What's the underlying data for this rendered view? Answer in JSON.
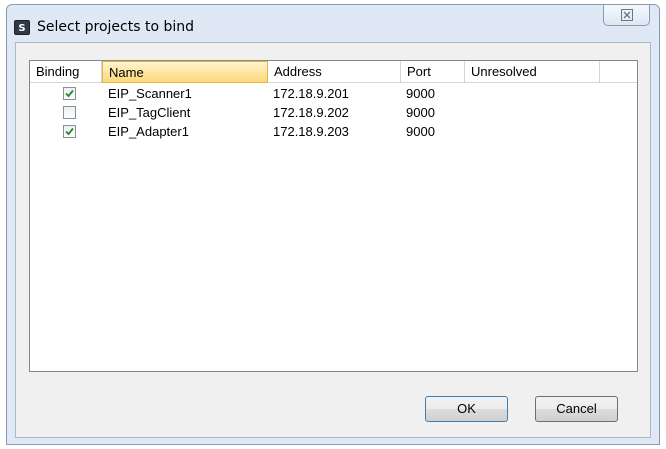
{
  "window": {
    "title": "Select projects to bind",
    "app_icon_letter": "S",
    "close_glyph": "⌧"
  },
  "list": {
    "columns": [
      "Binding",
      "Name",
      "Address",
      "Port",
      "Unresolved"
    ],
    "rows": [
      {
        "binding": true,
        "name": "EIP_Scanner1",
        "address": "172.18.9.201",
        "port": "9000",
        "unresolved": ""
      },
      {
        "binding": false,
        "name": "EIP_TagClient",
        "address": "172.18.9.202",
        "port": "9000",
        "unresolved": ""
      },
      {
        "binding": true,
        "name": "EIP_Adapter1",
        "address": "172.18.9.203",
        "port": "9000",
        "unresolved": ""
      }
    ]
  },
  "buttons": {
    "ok_label": "OK",
    "cancel_label": "Cancel"
  },
  "colors": {
    "checkmark": "#2c8a2c",
    "selected_header": "#fbd87a"
  }
}
